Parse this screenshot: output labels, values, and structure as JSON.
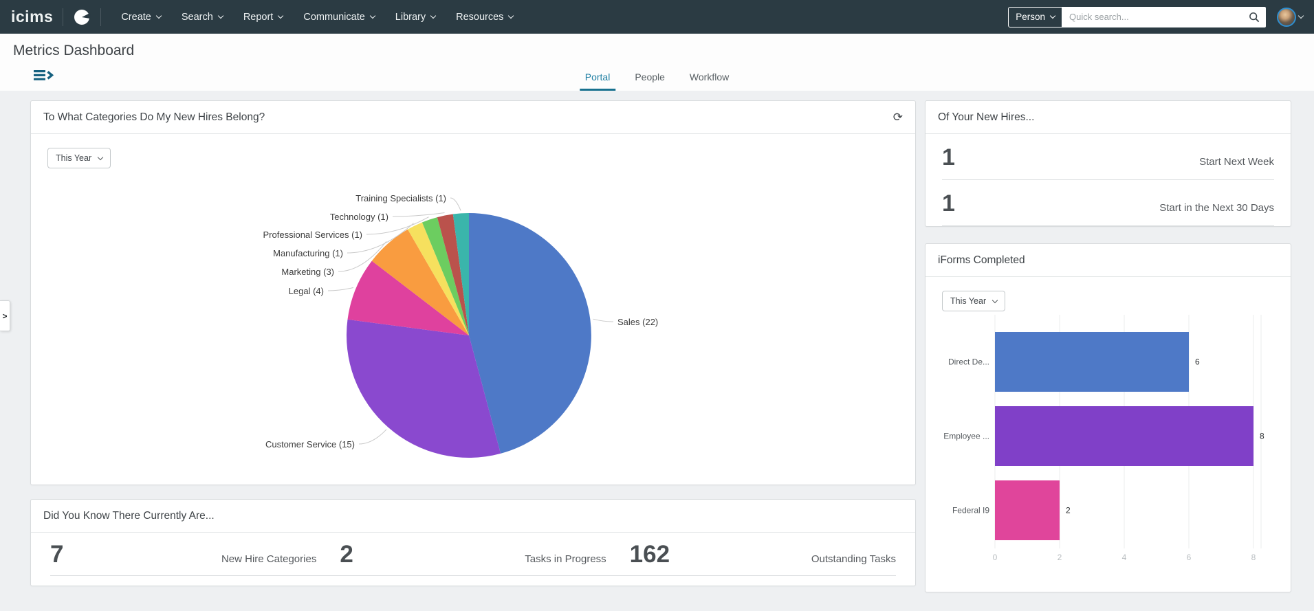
{
  "nav": {
    "brand": "icims",
    "menus": [
      "Create",
      "Search",
      "Report",
      "Communicate",
      "Library",
      "Resources"
    ],
    "search_scope": "Person",
    "search_placeholder": "Quick search..."
  },
  "page": {
    "title": "Metrics Dashboard"
  },
  "tabs": {
    "portal": "Portal",
    "people": "People",
    "workflow": "Workflow"
  },
  "icons": {
    "refresh": "⟳",
    "flyout": ">"
  },
  "panels": {
    "categories": {
      "title": "To What Categories Do My New Hires Belong?",
      "filter": "This Year"
    },
    "new_hires": {
      "title": "Of Your New Hires...",
      "stats": [
        {
          "value": "1",
          "label": "Start Next Week"
        },
        {
          "value": "1",
          "label": "Start in the Next 30 Days"
        }
      ]
    },
    "iforms": {
      "title": "iForms Completed",
      "filter": "This Year"
    },
    "did_you_know": {
      "title": "Did You Know There Currently Are...",
      "stats": [
        {
          "value": "7",
          "label": "New Hire Categories"
        },
        {
          "value": "2",
          "label": "Tasks in Progress"
        },
        {
          "value": "162",
          "label": "Outstanding Tasks"
        }
      ]
    }
  },
  "chart_data": [
    {
      "type": "pie",
      "title": "To What Categories Do My New Hires Belong?",
      "direction": "clockwise-from-top",
      "slices": [
        {
          "name": "Sales",
          "label": "Sales (22)",
          "value": 22,
          "color": "#4e79c7"
        },
        {
          "name": "Customer Service",
          "label": "Customer Service (15)",
          "value": 15,
          "color": "#8a49cf"
        },
        {
          "name": "Legal",
          "label": "Legal (4)",
          "value": 4,
          "color": "#df419e"
        },
        {
          "name": "Marketing",
          "label": "Marketing (3)",
          "value": 3,
          "color": "#f99c40"
        },
        {
          "name": "Manufacturing",
          "label": "Manufacturing (1)",
          "value": 1,
          "color": "#f6e05e"
        },
        {
          "name": "Professional Services",
          "label": "Professional Services (1)",
          "value": 1,
          "color": "#6ccd60"
        },
        {
          "name": "Technology",
          "label": "Technology (1)",
          "value": 1,
          "color": "#ba524c"
        },
        {
          "name": "Training Specialists",
          "label": "Training Specialists (1)",
          "value": 1,
          "color": "#3ab5ab"
        }
      ]
    },
    {
      "type": "bar",
      "orientation": "horizontal",
      "title": "iForms Completed",
      "categories": [
        "Direct De...",
        "Employee ...",
        "Federal I9"
      ],
      "values": [
        6,
        8,
        2
      ],
      "colors": [
        "#4e79c7",
        "#8040c8",
        "#e0459b"
      ],
      "xticks": [
        0,
        2,
        4,
        6,
        8
      ],
      "xlim": [
        0,
        8.8
      ],
      "grid": true
    }
  ]
}
